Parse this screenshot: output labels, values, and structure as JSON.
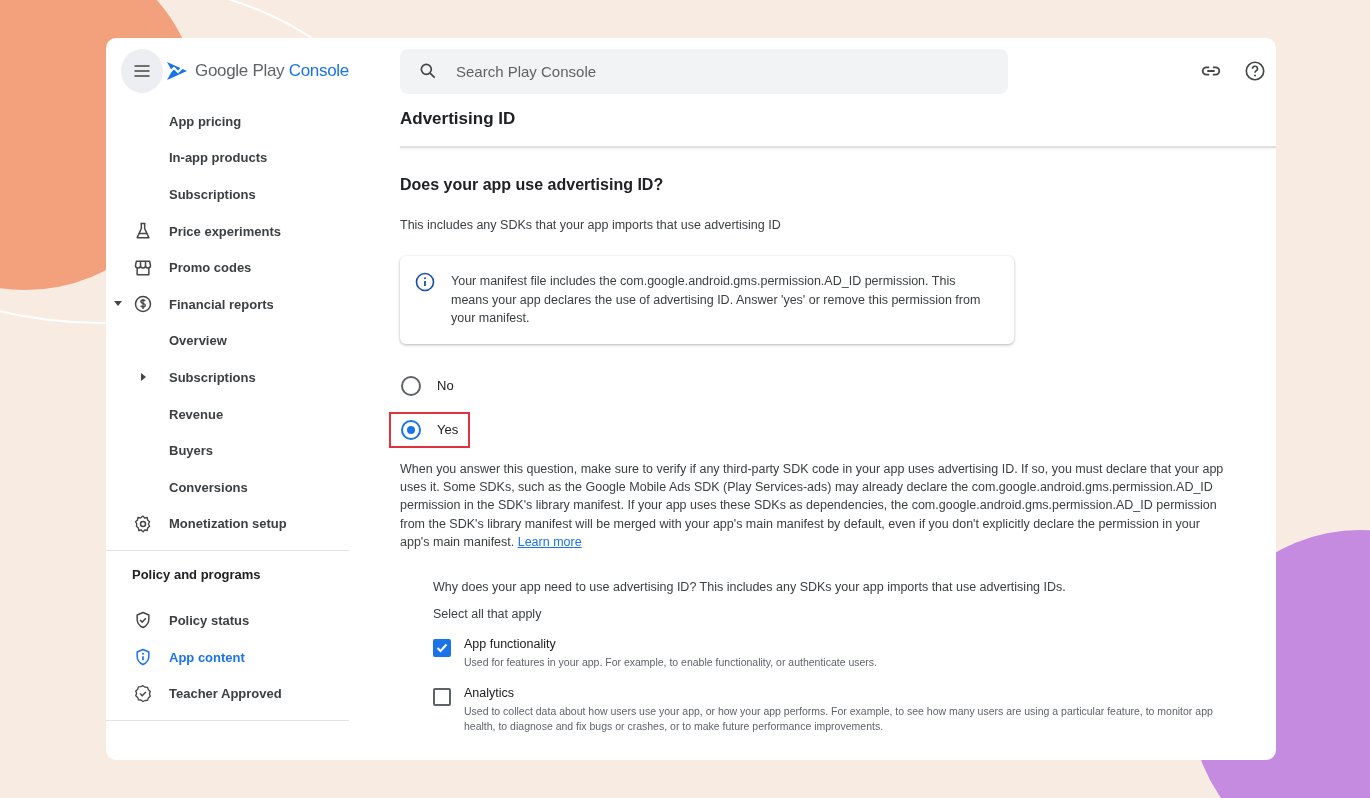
{
  "topbar": {
    "logo": {
      "brand": "Google Play",
      "product": "Console"
    },
    "search": {
      "placeholder": "Search Play Console"
    }
  },
  "sidebar": {
    "sections": [
      {
        "items": [
          {
            "label": "App pricing",
            "kind": "plain",
            "selected": false
          },
          {
            "label": "In-app products",
            "kind": "plain",
            "selected": false
          },
          {
            "label": "Subscriptions",
            "kind": "plain",
            "selected": false
          },
          {
            "label": "Price experiments",
            "kind": "icon",
            "selected": false
          },
          {
            "label": "Promo codes",
            "kind": "icon",
            "selected": false
          },
          {
            "label": "Financial reports",
            "kind": "icon",
            "selected": false,
            "expanded": true,
            "children": [
              {
                "label": "Overview",
                "kind": "plain",
                "selected": false
              },
              {
                "label": "Subscriptions",
                "kind": "plain",
                "selected": false,
                "expanded": false
              },
              {
                "label": "Revenue",
                "kind": "plain",
                "selected": false
              },
              {
                "label": "Buyers",
                "kind": "plain",
                "selected": false
              },
              {
                "label": "Conversions",
                "kind": "plain",
                "selected": false
              }
            ]
          },
          {
            "label": "Monetization setup",
            "kind": "icon",
            "selected": false
          }
        ]
      },
      {
        "heading": "Policy and programs",
        "items": [
          {
            "label": "Policy status",
            "kind": "icon",
            "selected": false
          },
          {
            "label": "App content",
            "kind": "icon",
            "selected": true
          },
          {
            "label": "Teacher Approved",
            "kind": "icon",
            "selected": false
          }
        ]
      }
    ]
  },
  "page": {
    "title": "Advertising ID",
    "question": "Does your app use advertising ID?",
    "subtitle": "This includes any SDKs that your app imports that use advertising ID",
    "info": "Your manifest file includes the com.google.android.gms.permission.AD_ID permission. This means your app declares the use of advertising ID. Answer 'yes' or remove this permission from your manifest.",
    "options": [
      {
        "label": "No",
        "selected": false,
        "highlighted": false
      },
      {
        "label": "Yes",
        "selected": true,
        "highlighted": true
      }
    ],
    "note": "When you answer this question, make sure to verify if any third-party SDK code in your app uses advertising ID. If so, you must declare that your app uses it. Some SDKs, such as the Google Mobile Ads SDK (Play Services-ads) may already declare the com.google.android.gms.permission.AD_ID permission in the SDK's library manifest. If your app uses these SDKs as dependencies, the com.google.android.gms.permission.AD_ID permission from the SDK's library manifest will be merged with your app's main manifest by default, even if you don't explicitly declare the permission in your app's main manifest.",
    "note_link": "Learn more",
    "purpose": {
      "question": "Why does your app need to use advertising ID? This includes any SDKs your app imports that use advertising IDs.",
      "hint": "Select all that apply",
      "choices": [
        {
          "label": "App functionality",
          "description": "Used for features in your app. For example, to enable functionality, or authenticate users.",
          "checked": true
        },
        {
          "label": "Analytics",
          "description": "Used to collect data about how users use your app, or how your app performs. For example, to see how many users are using a particular feature, to monitor app health, to diagnose and fix bugs or crashes, or to make future performance improvements.",
          "checked": false
        }
      ]
    }
  }
}
